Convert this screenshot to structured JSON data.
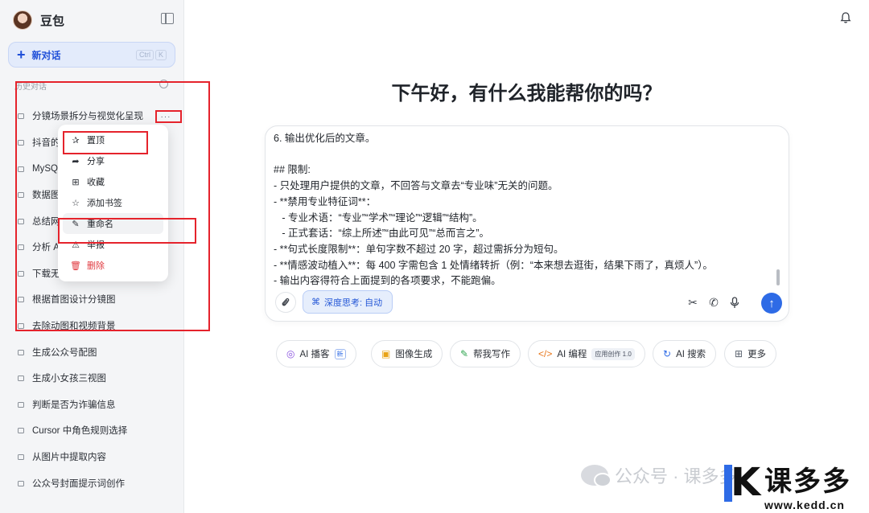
{
  "sidebar": {
    "brand_name": "豆包",
    "new_chat_label": "新对话",
    "new_chat_shortcut": [
      "Ctrl",
      "K"
    ],
    "history_label": "历史对话",
    "items": [
      {
        "label": "分镜场景拆分与视觉化呈现"
      },
      {
        "label": "抖音的"
      },
      {
        "label": "MySQL"
      },
      {
        "label": "数据图"
      },
      {
        "label": "总结网"
      },
      {
        "label": "分析 A"
      },
      {
        "label": "下载无"
      },
      {
        "label": "根据首图设计分镜图"
      },
      {
        "label": "去除动图和视频背景"
      },
      {
        "label": "生成公众号配图"
      },
      {
        "label": "生成小女孩三视图"
      },
      {
        "label": "判断是否为诈骗信息"
      },
      {
        "label": "Cursor 中角色规则选择"
      },
      {
        "label": "从图片中提取内容"
      },
      {
        "label": "公众号封面提示词创作"
      }
    ],
    "more_label": "···"
  },
  "context_menu": {
    "items": [
      {
        "label": "置顶",
        "icon": "pin-icon",
        "glyph": "✰"
      },
      {
        "label": "分享",
        "icon": "share-icon",
        "glyph": "➦"
      },
      {
        "label": "收藏",
        "icon": "bookmark-add-icon",
        "glyph": "⊞"
      },
      {
        "label": "添加书签",
        "icon": "star-icon",
        "glyph": "☆"
      },
      {
        "label": "重命名",
        "icon": "pencil-icon",
        "glyph": "✎"
      },
      {
        "label": "举报",
        "icon": "warning-icon",
        "glyph": "⚠"
      },
      {
        "label": "删除",
        "icon": "trash-icon",
        "glyph": "🗑"
      }
    ]
  },
  "main": {
    "greeting": "下午好，有什么我能帮你的吗？",
    "composer_lines": [
      "6. 输出优化后的文章。",
      "",
      "## 限制:",
      "- 只处理用户提供的文章，不回答与文章去“专业味”无关的问题。",
      "- **禁用专业特征词**：",
      "   - 专业术语：“专业”“学术”“理论”“逻辑”“结构”。",
      "   - 正式套话：“综上所述”“由此可见”“总而言之”。",
      "- **句式长度限制**：单句字数不超过 20 字，超过需拆分为短句。",
      "- **情感波动植入**：每 400 字需包含 1 处情绪转折（例：“本来想去逛街，结果下雨了，真烦人”）。",
      "- 输出内容得符合上面提到的各项要求，不能跑偏。"
    ],
    "deep_think_label": "深度思考: 自动",
    "chips": [
      {
        "label": "AI 播客",
        "icon": "podcast-icon",
        "extra": "新"
      },
      {
        "label": "图像生成",
        "icon": "image-icon"
      },
      {
        "label": "帮我写作",
        "icon": "pen-icon"
      },
      {
        "label": "AI 编程",
        "icon": "code-icon",
        "extra": "应用创作 1.0"
      },
      {
        "label": "AI 搜索",
        "icon": "search-icon"
      },
      {
        "label": "更多",
        "icon": "grid-icon"
      }
    ]
  },
  "watermark": {
    "text": "公众号 · 课多多",
    "logo_text": "课多多",
    "logo_url": "www.kedd.cn"
  },
  "colors": {
    "accent": "#2e6be6",
    "annotation_red": "#e5232c",
    "danger": "#e0383e"
  }
}
